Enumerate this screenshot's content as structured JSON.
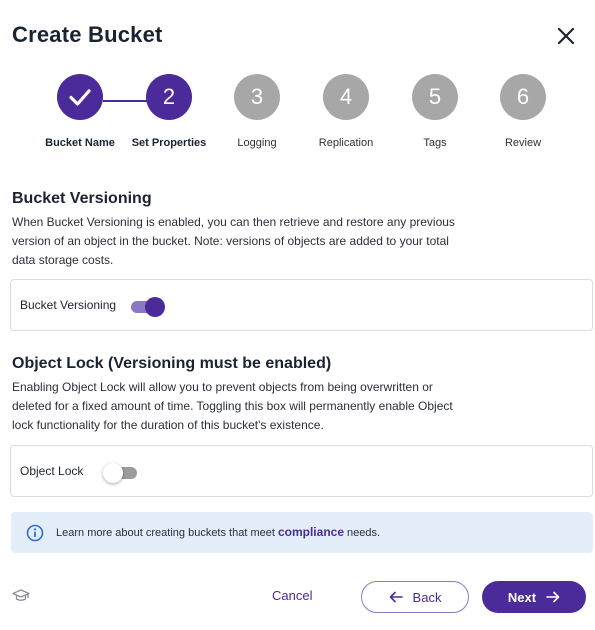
{
  "header": {
    "title": "Create Bucket",
    "close_icon": "close-icon"
  },
  "stepper": {
    "steps": [
      {
        "number": "",
        "label": "Bucket Name",
        "state": "done"
      },
      {
        "number": "2",
        "label": "Set Properties",
        "state": "active"
      },
      {
        "number": "3",
        "label": "Logging",
        "state": "pending"
      },
      {
        "number": "4",
        "label": "Replication",
        "state": "pending"
      },
      {
        "number": "5",
        "label": "Tags",
        "state": "pending"
      },
      {
        "number": "6",
        "label": "Review",
        "state": "pending"
      }
    ]
  },
  "versioning": {
    "title": "Bucket Versioning",
    "description": "When Bucket Versioning is enabled, you can then retrieve and restore any previous version of an object in the bucket. Note: versions of objects are added to your total data storage costs.",
    "toggle_label": "Bucket Versioning",
    "enabled": true
  },
  "object_lock": {
    "title": "Object Lock (Versioning must be enabled)",
    "description": "Enabling Object Lock will allow you to prevent objects from being overwritten or deleted for a fixed amount of time. Toggling this box will permanently enable Object lock functionality for the duration of this bucket's existence.",
    "toggle_label": "Object Lock",
    "enabled": false
  },
  "info": {
    "text_before": "Learn more about creating buckets that meet ",
    "link": "compliance",
    "text_after": " needs."
  },
  "footer": {
    "cancel_label": "Cancel",
    "back_label": "Back",
    "next_label": "Next"
  },
  "colors": {
    "primary": "#4b2a99",
    "pending_step": "#a7a7a7",
    "info_bg": "#e3eefa"
  }
}
